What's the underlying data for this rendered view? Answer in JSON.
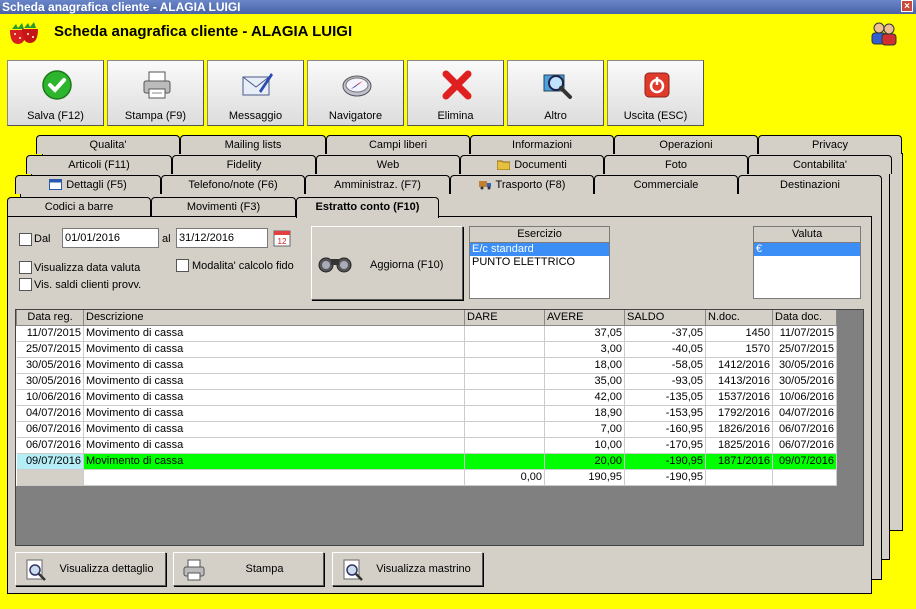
{
  "window": {
    "title": "Scheda anagrafica cliente - ALAGIA LUIGI",
    "close": "×"
  },
  "header": {
    "title": "Scheda anagrafica cliente - ALAGIA LUIGI"
  },
  "toolbar": [
    {
      "label": "Salva (F12)",
      "icon": "save-check-icon"
    },
    {
      "label": "Stampa (F9)",
      "icon": "printer-icon"
    },
    {
      "label": "Messaggio",
      "icon": "message-icon"
    },
    {
      "label": "Navigatore",
      "icon": "compass-icon"
    },
    {
      "label": "Elimina",
      "icon": "delete-x-icon"
    },
    {
      "label": "Altro",
      "icon": "magnifier-icon"
    },
    {
      "label": "Uscita (ESC)",
      "icon": "exit-icon"
    }
  ],
  "tabs": {
    "row1": [
      "Qualita'",
      "Mailing lists",
      "Campi liberi",
      "Informazioni",
      "Operazioni",
      "Privacy"
    ],
    "row2": [
      "Articoli (F11)",
      "Fidelity",
      "Web",
      "Documenti",
      "Foto",
      "Contabilita'"
    ],
    "row3": [
      "Dettagli (F5)",
      "Telefono/note (F6)",
      "Amministraz. (F7)",
      "Trasporto (F8)",
      "Commerciale",
      "Destinazioni"
    ],
    "row4": [
      "Codici a barre",
      "Movimenti (F3)",
      "Estratto conto (F10)"
    ]
  },
  "filters": {
    "dal_label": "Dal",
    "date_from": "01/01/2016",
    "al_label": "al",
    "date_to": "31/12/2016",
    "calendar_day": "12",
    "visualizza_data_valuta": "Visualizza data valuta",
    "vis_saldi": "Vis. saldi clienti provv.",
    "modalita_fido": "Modalita' calcolo fido",
    "aggiorna": "Aggiorna (F10)"
  },
  "esercizio": {
    "header": "Esercizio",
    "items": [
      "E/c standard",
      "PUNTO ELETTRICO"
    ],
    "selected": 0
  },
  "valuta": {
    "header": "Valuta",
    "items": [
      "€"
    ],
    "selected": 0
  },
  "grid": {
    "columns": [
      "Data reg.",
      "Descrizione",
      "DARE",
      "AVERE",
      "SALDO",
      "N.doc.",
      "Data doc."
    ],
    "rows": [
      [
        "11/07/2015",
        "Movimento di cassa",
        "",
        "37,05",
        "-37,05",
        "1450",
        "11/07/2015"
      ],
      [
        "25/07/2015",
        "Movimento di cassa",
        "",
        "3,00",
        "-40,05",
        "1570",
        "25/07/2015"
      ],
      [
        "30/05/2016",
        "Movimento di cassa",
        "",
        "18,00",
        "-58,05",
        "1412/2016",
        "30/05/2016"
      ],
      [
        "30/05/2016",
        "Movimento di cassa",
        "",
        "35,00",
        "-93,05",
        "1413/2016",
        "30/05/2016"
      ],
      [
        "10/06/2016",
        "Movimento di cassa",
        "",
        "42,00",
        "-135,05",
        "1537/2016",
        "10/06/2016"
      ],
      [
        "04/07/2016",
        "Movimento di cassa",
        "",
        "18,90",
        "-153,95",
        "1792/2016",
        "04/07/2016"
      ],
      [
        "06/07/2016",
        "Movimento di cassa",
        "",
        "7,00",
        "-160,95",
        "1826/2016",
        "06/07/2016"
      ],
      [
        "06/07/2016",
        "Movimento di cassa",
        "",
        "10,00",
        "-170,95",
        "1825/2016",
        "06/07/2016"
      ],
      [
        "09/07/2016",
        "Movimento di cassa",
        "",
        "20,00",
        "-190,95",
        "1871/2016",
        "09/07/2016"
      ]
    ],
    "selected_row": 8,
    "totals": [
      "",
      "",
      "0,00",
      "190,95",
      "-190,95",
      "",
      ""
    ]
  },
  "bottom_buttons": [
    "Visualizza dettaglio",
    "Stampa",
    "Visualizza mastrino"
  ],
  "colors": {
    "window_bg": "#ffff00",
    "panel": "#d4d0c8",
    "selected_row": "#00ff00",
    "list_selection": "#3a8ef5"
  }
}
